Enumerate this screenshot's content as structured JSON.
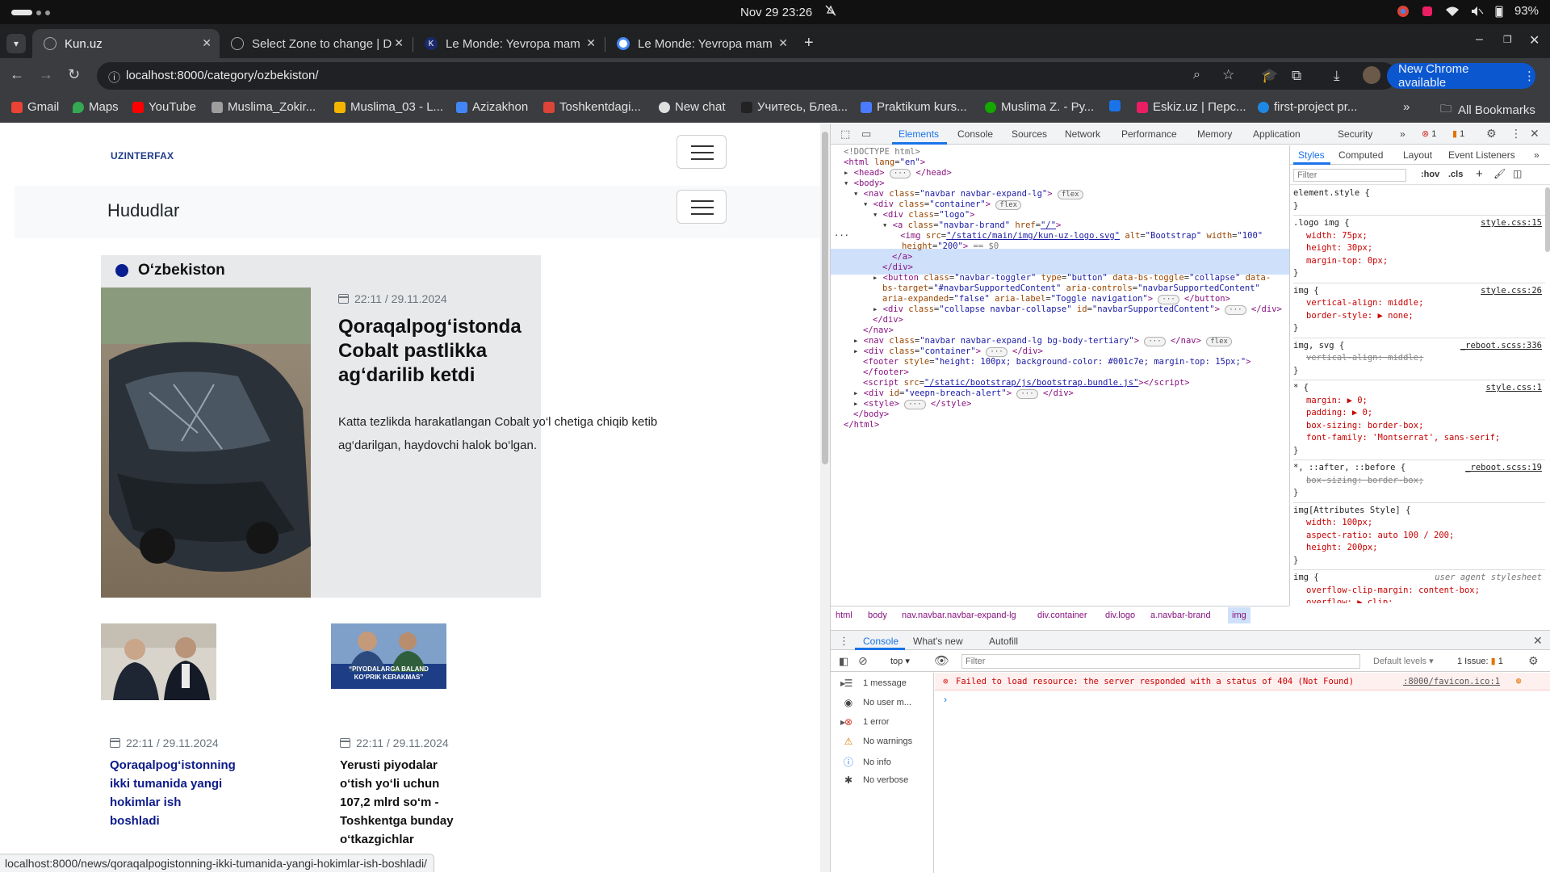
{
  "system": {
    "clock": "Nov 29  23:26",
    "battery": "93%"
  },
  "tabs": [
    {
      "label": "Kun.uz",
      "active": true
    },
    {
      "label": "Select Zone to change | D",
      "active": false
    },
    {
      "label": "Le Monde: Yevropa mam",
      "active": false
    },
    {
      "label": "Le Monde: Yevropa mam",
      "active": false
    }
  ],
  "toolbar": {
    "url": "localhost:8000/category/ozbekiston/",
    "new_chrome": "New Chrome available"
  },
  "bookmarks": [
    {
      "label": "Gmail",
      "color": "#ea4335"
    },
    {
      "label": "Maps",
      "color": "#34a853"
    },
    {
      "label": "YouTube",
      "color": "#ff0000"
    },
    {
      "label": "Muslima_Zokir...",
      "color": "#9e9e9e"
    },
    {
      "label": "Muslima_03 - L...",
      "color": "#f4b400"
    },
    {
      "label": "Azizakhon",
      "color": "#4285f4"
    },
    {
      "label": "Toshkentdagi...",
      "color": "#db4437"
    },
    {
      "label": "New chat",
      "color": "#e0e0e0"
    },
    {
      "label": "Учитесь, Блеа...",
      "color": "#222222"
    },
    {
      "label": "Praktikum kurs...",
      "color": "#4a7bff"
    },
    {
      "label": "Muslima Z. - Ру...",
      "color": "#14a800"
    },
    {
      "label": "",
      "color": "#1a73e8"
    },
    {
      "label": "Eskiz.uz | Перс...",
      "color": "#e91e63"
    },
    {
      "label": "first-project pr...",
      "color": "#1e88e5"
    }
  ],
  "all_bookmarks": "All Bookmarks",
  "page": {
    "logo": "UZINTERFAX",
    "section_title": "Hududlar",
    "category": "O‘zbekiston",
    "featured": {
      "meta": "22:11 / 29.11.2024",
      "title_lines": [
        "Qoraqalpog‘istonda",
        "Cobalt pastlikka",
        "ag‘darilib ketdi"
      ],
      "desc_lines": [
        "Katta tezlikda harakatlangan Cobalt yo‘l chetiga chiqib ketib",
        "ag‘darilgan, haydovchi halok bo‘lgan."
      ]
    },
    "cards": [
      {
        "meta": "22:11 / 29.11.2024",
        "title_lines": [
          "Qoraqalpog‘istonning",
          "ikki tumanida yangi",
          "hokimlar ish",
          "boshladi"
        ]
      },
      {
        "meta": "22:11 / 29.11.2024",
        "title_lines": [
          "Yerusti piyodalar",
          "o‘tish yo‘li uchun",
          "107,2 mlrd so‘m -",
          "Toshkentga bunday",
          "o‘tkazgichlar"
        ],
        "image_caption_lines": [
          "“PIYODALARGA BALAND",
          "KO‘PRIK KERAKMAS”"
        ]
      }
    ],
    "status_url": "localhost:8000/news/qoraqalpogistonning-ikki-tumanida-yangi-hokimlar-ish-boshladi/"
  },
  "devtools": {
    "tabs": [
      "Elements",
      "Console",
      "Sources",
      "Network",
      "Performance",
      "Memory",
      "Application",
      "Security"
    ],
    "error_count": "1",
    "warn_count": "1",
    "styles_tabs": [
      "Styles",
      "Computed",
      "Layout",
      "Event Listeners"
    ],
    "filter_placeholder": "Filter",
    "hov": ":hov",
    "cls": ".cls",
    "breadcrumbs": [
      "html",
      "body",
      "nav.navbar.navbar-expand-lg",
      "div.container",
      "div.logo",
      "a.navbar-brand",
      "img"
    ],
    "drawer_tabs": [
      "Console",
      "What's new",
      "Autofill"
    ],
    "console_context": "top",
    "console_filter": "Filter",
    "default_levels": "Default levels",
    "issues": "1 Issue:",
    "issues_count": "1",
    "sidebar": [
      "1 message",
      "No user m...",
      "1 error",
      "No warnings",
      "No info",
      "No verbose"
    ],
    "error_message": "Failed to load resource: the server responded with a status of 404 (Not Found)",
    "error_source": ":8000/favicon.ico:1",
    "css_rules": [
      {
        "selector": "element.style {",
        "source": "",
        "props": []
      },
      {
        "selector": ".logo img {",
        "source": "style.css:15",
        "props": [
          "width: 75px;",
          "height: 30px;",
          "margin-top: 0px;"
        ]
      },
      {
        "selector": "img {",
        "source": "style.css:26",
        "props": [
          "vertical-align: middle;",
          "border-style: ▶ none;"
        ]
      },
      {
        "selector": "img, svg {",
        "source": "_reboot.scss:336",
        "props": [
          "vertical-align: middle;"
        ],
        "strike": true
      },
      {
        "selector": "* {",
        "source": "style.css:1",
        "props": [
          "margin: ▶ 0;",
          "padding: ▶ 0;",
          "box-sizing: border-box;",
          "font-family: 'Montserrat', sans-serif;"
        ]
      },
      {
        "selector": "*, ::after, ::before {",
        "source": "_reboot.scss:19",
        "props": [
          "box-sizing: border-box;"
        ],
        "strike": true
      },
      {
        "selector": "img[Attributes Style] {",
        "source": "",
        "props": [
          "width: 100px;",
          "aspect-ratio: auto 100 / 200;",
          "height: 200px;"
        ]
      },
      {
        "selector": "img {",
        "source": "user agent stylesheet",
        "props": [
          "overflow-clip-margin: content-box;",
          "overflow: ▶ clip;"
        ]
      }
    ]
  }
}
